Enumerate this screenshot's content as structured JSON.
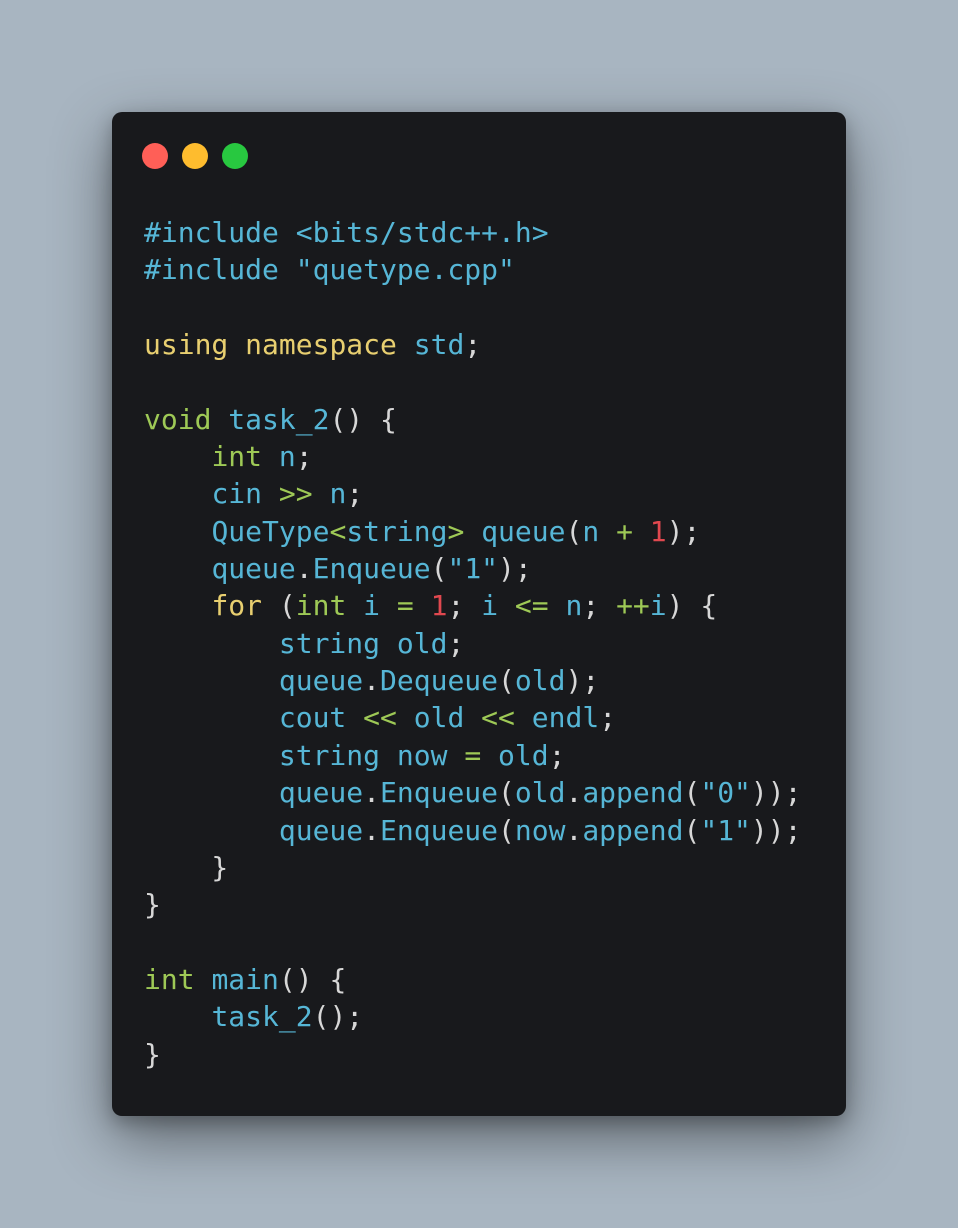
{
  "window": {
    "controls": [
      {
        "name": "close",
        "color": "#ff5f57"
      },
      {
        "name": "minimize",
        "color": "#febc2e"
      },
      {
        "name": "maximize",
        "color": "#28c840"
      }
    ]
  },
  "code": {
    "language": "cpp",
    "lines": [
      [
        [
          "pre",
          "#include <bits/stdc++.h>"
        ]
      ],
      [
        [
          "pre",
          "#include \"quetype.cpp\""
        ]
      ],
      [],
      [
        [
          "kw",
          "using"
        ],
        [
          "p",
          " "
        ],
        [
          "kw",
          "namespace"
        ],
        [
          "p",
          " "
        ],
        [
          "id",
          "std"
        ],
        [
          "p",
          ";"
        ]
      ],
      [],
      [
        [
          "type",
          "void"
        ],
        [
          "p",
          " "
        ],
        [
          "id",
          "task_2"
        ],
        [
          "p",
          "() {"
        ]
      ],
      [
        [
          "p",
          "    "
        ],
        [
          "type",
          "int"
        ],
        [
          "p",
          " "
        ],
        [
          "id",
          "n"
        ],
        [
          "p",
          ";"
        ]
      ],
      [
        [
          "p",
          "    "
        ],
        [
          "id",
          "cin"
        ],
        [
          "p",
          " "
        ],
        [
          "op",
          ">>"
        ],
        [
          "p",
          " "
        ],
        [
          "id",
          "n"
        ],
        [
          "p",
          ";"
        ]
      ],
      [
        [
          "p",
          "    "
        ],
        [
          "id",
          "QueType"
        ],
        [
          "op",
          "<"
        ],
        [
          "id",
          "string"
        ],
        [
          "op",
          ">"
        ],
        [
          "p",
          " "
        ],
        [
          "id",
          "queue"
        ],
        [
          "p",
          "("
        ],
        [
          "id",
          "n"
        ],
        [
          "p",
          " "
        ],
        [
          "op",
          "+"
        ],
        [
          "p",
          " "
        ],
        [
          "num",
          "1"
        ],
        [
          "p",
          ");"
        ]
      ],
      [
        [
          "p",
          "    "
        ],
        [
          "id",
          "queue"
        ],
        [
          "p",
          "."
        ],
        [
          "id",
          "Enqueue"
        ],
        [
          "p",
          "("
        ],
        [
          "str",
          "\"1\""
        ],
        [
          "p",
          ");"
        ]
      ],
      [
        [
          "p",
          "    "
        ],
        [
          "kw",
          "for"
        ],
        [
          "p",
          " ("
        ],
        [
          "type",
          "int"
        ],
        [
          "p",
          " "
        ],
        [
          "id",
          "i"
        ],
        [
          "p",
          " "
        ],
        [
          "op",
          "="
        ],
        [
          "p",
          " "
        ],
        [
          "num",
          "1"
        ],
        [
          "p",
          "; "
        ],
        [
          "id",
          "i"
        ],
        [
          "p",
          " "
        ],
        [
          "op",
          "<="
        ],
        [
          "p",
          " "
        ],
        [
          "id",
          "n"
        ],
        [
          "p",
          "; "
        ],
        [
          "op",
          "++"
        ],
        [
          "id",
          "i"
        ],
        [
          "p",
          ") {"
        ]
      ],
      [
        [
          "p",
          "        "
        ],
        [
          "id",
          "string"
        ],
        [
          "p",
          " "
        ],
        [
          "id",
          "old"
        ],
        [
          "p",
          ";"
        ]
      ],
      [
        [
          "p",
          "        "
        ],
        [
          "id",
          "queue"
        ],
        [
          "p",
          "."
        ],
        [
          "id",
          "Dequeue"
        ],
        [
          "p",
          "("
        ],
        [
          "id",
          "old"
        ],
        [
          "p",
          ");"
        ]
      ],
      [
        [
          "p",
          "        "
        ],
        [
          "id",
          "cout"
        ],
        [
          "p",
          " "
        ],
        [
          "op",
          "<<"
        ],
        [
          "p",
          " "
        ],
        [
          "id",
          "old"
        ],
        [
          "p",
          " "
        ],
        [
          "op",
          "<<"
        ],
        [
          "p",
          " "
        ],
        [
          "id",
          "endl"
        ],
        [
          "p",
          ";"
        ]
      ],
      [
        [
          "p",
          "        "
        ],
        [
          "id",
          "string"
        ],
        [
          "p",
          " "
        ],
        [
          "id",
          "now"
        ],
        [
          "p",
          " "
        ],
        [
          "op",
          "="
        ],
        [
          "p",
          " "
        ],
        [
          "id",
          "old"
        ],
        [
          "p",
          ";"
        ]
      ],
      [
        [
          "p",
          "        "
        ],
        [
          "id",
          "queue"
        ],
        [
          "p",
          "."
        ],
        [
          "id",
          "Enqueue"
        ],
        [
          "p",
          "("
        ],
        [
          "id",
          "old"
        ],
        [
          "p",
          "."
        ],
        [
          "id",
          "append"
        ],
        [
          "p",
          "("
        ],
        [
          "str",
          "\"0\""
        ],
        [
          "p",
          "));"
        ]
      ],
      [
        [
          "p",
          "        "
        ],
        [
          "id",
          "queue"
        ],
        [
          "p",
          "."
        ],
        [
          "id",
          "Enqueue"
        ],
        [
          "p",
          "("
        ],
        [
          "id",
          "now"
        ],
        [
          "p",
          "."
        ],
        [
          "id",
          "append"
        ],
        [
          "p",
          "("
        ],
        [
          "str",
          "\"1\""
        ],
        [
          "p",
          "));"
        ]
      ],
      [
        [
          "p",
          "    }"
        ]
      ],
      [
        [
          "p",
          "}"
        ]
      ],
      [],
      [
        [
          "type",
          "int"
        ],
        [
          "p",
          " "
        ],
        [
          "id",
          "main"
        ],
        [
          "p",
          "() {"
        ]
      ],
      [
        [
          "p",
          "    "
        ],
        [
          "id",
          "task_2"
        ],
        [
          "p",
          "();"
        ]
      ],
      [
        [
          "p",
          "}"
        ]
      ]
    ]
  }
}
